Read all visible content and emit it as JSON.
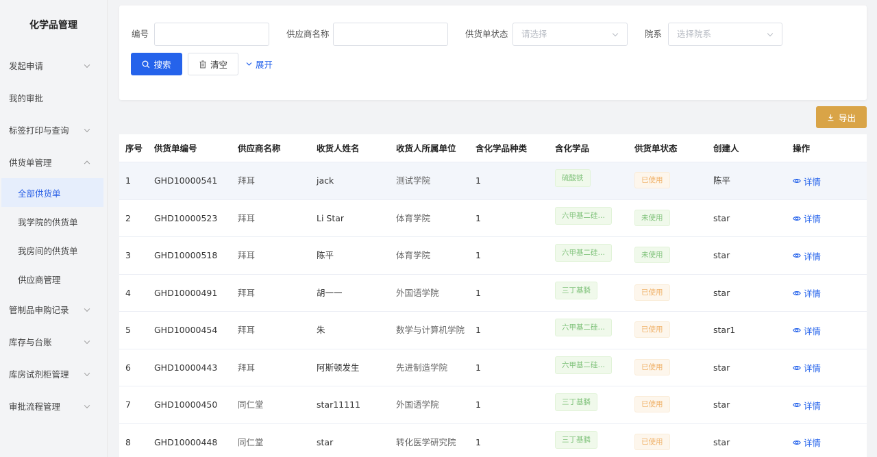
{
  "sidebar": {
    "title": "化学品管理",
    "menu": [
      {
        "label": "发起申请",
        "chevron": "down"
      },
      {
        "label": "我的审批",
        "chevron": "none"
      },
      {
        "label": "标签打印与查询",
        "chevron": "down"
      },
      {
        "label": "供货单管理",
        "chevron": "up"
      }
    ],
    "submenu": [
      {
        "label": "全部供货单",
        "active": true
      },
      {
        "label": "我学院的供货单"
      },
      {
        "label": "我房间的供货单"
      },
      {
        "label": "供应商管理"
      }
    ],
    "menu_after": [
      {
        "label": "管制品申购记录"
      },
      {
        "label": "库存与台账"
      },
      {
        "label": "库房试剂柜管理"
      },
      {
        "label": "审批流程管理"
      }
    ]
  },
  "filters": {
    "code_label": "编号",
    "code_value": "",
    "supplier_label": "供应商名称",
    "supplier_value": "",
    "status_label": "供货单状态",
    "status_placeholder": "请选择",
    "dept_label": "院系",
    "dept_placeholder": "选择院系",
    "search_label": "搜索",
    "clear_label": "清空",
    "expand_label": "展开"
  },
  "export_label": "导出",
  "table": {
    "headers": [
      "序号",
      "供货单编号",
      "供应商名称",
      "收货人姓名",
      "收货人所属单位",
      "含化学品种类",
      "含化学品",
      "供货单状态",
      "创建人",
      "操作"
    ],
    "action_label": "详情",
    "rows": [
      {
        "no": "1",
        "code": "GHD10000541",
        "supplier": "拜耳",
        "receiver": "jack",
        "unit": "测试学院",
        "kinds": "1",
        "chem": "硫酸铁",
        "status": "已使用",
        "creator": "陈平"
      },
      {
        "no": "2",
        "code": "GHD10000523",
        "supplier": "拜耳",
        "receiver": "Li Star",
        "unit": "体育学院",
        "kinds": "1",
        "chem": "六甲基二硅…",
        "status": "未使用",
        "creator": "star"
      },
      {
        "no": "3",
        "code": "GHD10000518",
        "supplier": "拜耳",
        "receiver": "陈平",
        "unit": "体育学院",
        "kinds": "1",
        "chem": "六甲基二硅…",
        "status": "未使用",
        "creator": "star"
      },
      {
        "no": "4",
        "code": "GHD10000491",
        "supplier": "拜耳",
        "receiver": "胡一一",
        "unit": "外国语学院",
        "kinds": "1",
        "chem": "三丁基膦",
        "status": "已使用",
        "creator": "star"
      },
      {
        "no": "5",
        "code": "GHD10000454",
        "supplier": "拜耳",
        "receiver": "朱",
        "unit": "数学与计算机学院",
        "kinds": "1",
        "chem": "六甲基二硅…",
        "status": "已使用",
        "creator": "star1"
      },
      {
        "no": "6",
        "code": "GHD10000443",
        "supplier": "拜耳",
        "receiver": "阿斯顿发生",
        "unit": "先进制造学院",
        "kinds": "1",
        "chem": "六甲基二硅…",
        "status": "已使用",
        "creator": "star"
      },
      {
        "no": "7",
        "code": "GHD10000450",
        "supplier": "同仁堂",
        "receiver": "star11111",
        "unit": "外国语学院",
        "kinds": "1",
        "chem": "三丁基膦",
        "status": "已使用",
        "creator": "star"
      },
      {
        "no": "8",
        "code": "GHD10000448",
        "supplier": "同仁堂",
        "receiver": "star",
        "unit": "转化医学研究院",
        "kinds": "1",
        "chem": "三丁基膦",
        "status": "已使用",
        "creator": "star"
      }
    ]
  },
  "colors": {
    "primary": "#2563eb",
    "export": "#d9a447",
    "used_tag": "#f0b26a",
    "unused_tag": "#7fc27a"
  }
}
